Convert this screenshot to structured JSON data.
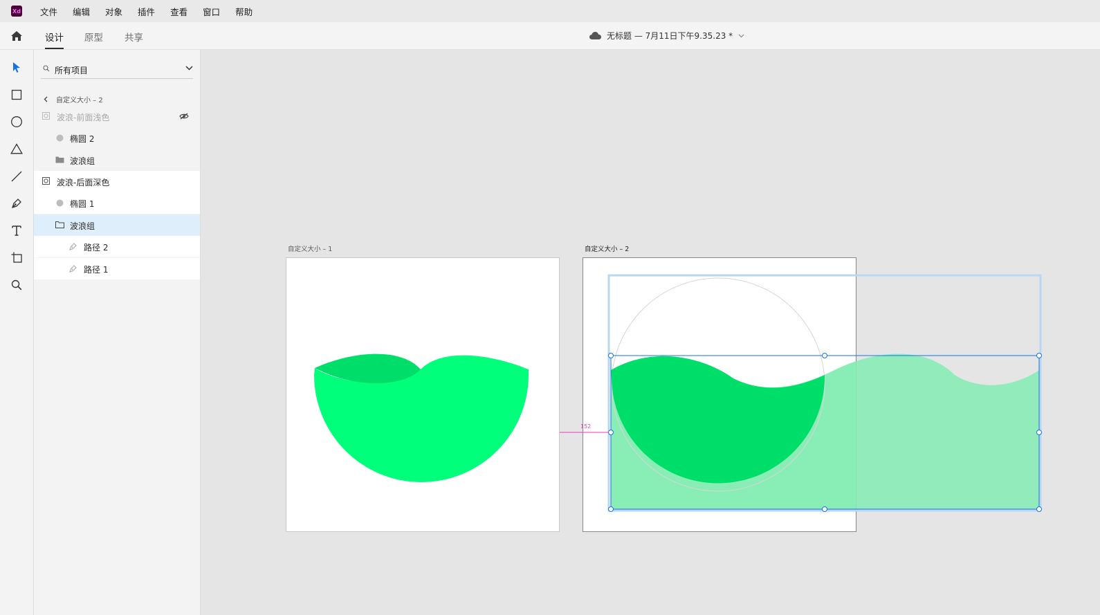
{
  "app": {
    "logo_text": "Xd",
    "menu": [
      "文件",
      "编辑",
      "对象",
      "插件",
      "查看",
      "窗口",
      "帮助"
    ]
  },
  "tabs": [
    {
      "label": "设计",
      "active": true
    },
    {
      "label": "原型",
      "active": false
    },
    {
      "label": "共享",
      "active": false
    }
  ],
  "document": {
    "title": "无标题 — 7月11日下午9.35.23 *"
  },
  "tools": [
    "select-icon",
    "rectangle-icon",
    "ellipse-icon",
    "polygon-icon",
    "line-icon",
    "pen-icon",
    "text-icon",
    "artboard-icon",
    "zoom-icon"
  ],
  "layers": {
    "filter_value": "所有项目",
    "back_label": "自定义大小 – 2",
    "items": [
      {
        "label": "波浪-前面浅色",
        "icon": "group-mask-icon",
        "hidden": true
      },
      {
        "label": "椭圆 2",
        "icon": "ellipse-layer-icon"
      },
      {
        "label": "波浪组",
        "icon": "folder-filled-icon"
      },
      {
        "label": "波浪-后面深色",
        "icon": "group-mask-icon"
      },
      {
        "label": "椭圆 1",
        "icon": "ellipse-layer-icon"
      },
      {
        "label": "波浪组",
        "icon": "folder-outline-icon",
        "selected": true
      },
      {
        "label": "路径 2",
        "icon": "path-icon"
      },
      {
        "label": "路径 1",
        "icon": "path-icon"
      }
    ]
  },
  "canvas": {
    "artboards": [
      {
        "label": "自定义大小 – 1"
      },
      {
        "label": "自定义大小 – 2"
      }
    ],
    "distance_label": "152"
  },
  "colors": {
    "bright_green": "#00ff7a",
    "dark_green": "#00de6a",
    "light_green_overlay": "#7eedb0",
    "selection_blue": "#1473e6",
    "measure_magenta": "#e040c0"
  }
}
